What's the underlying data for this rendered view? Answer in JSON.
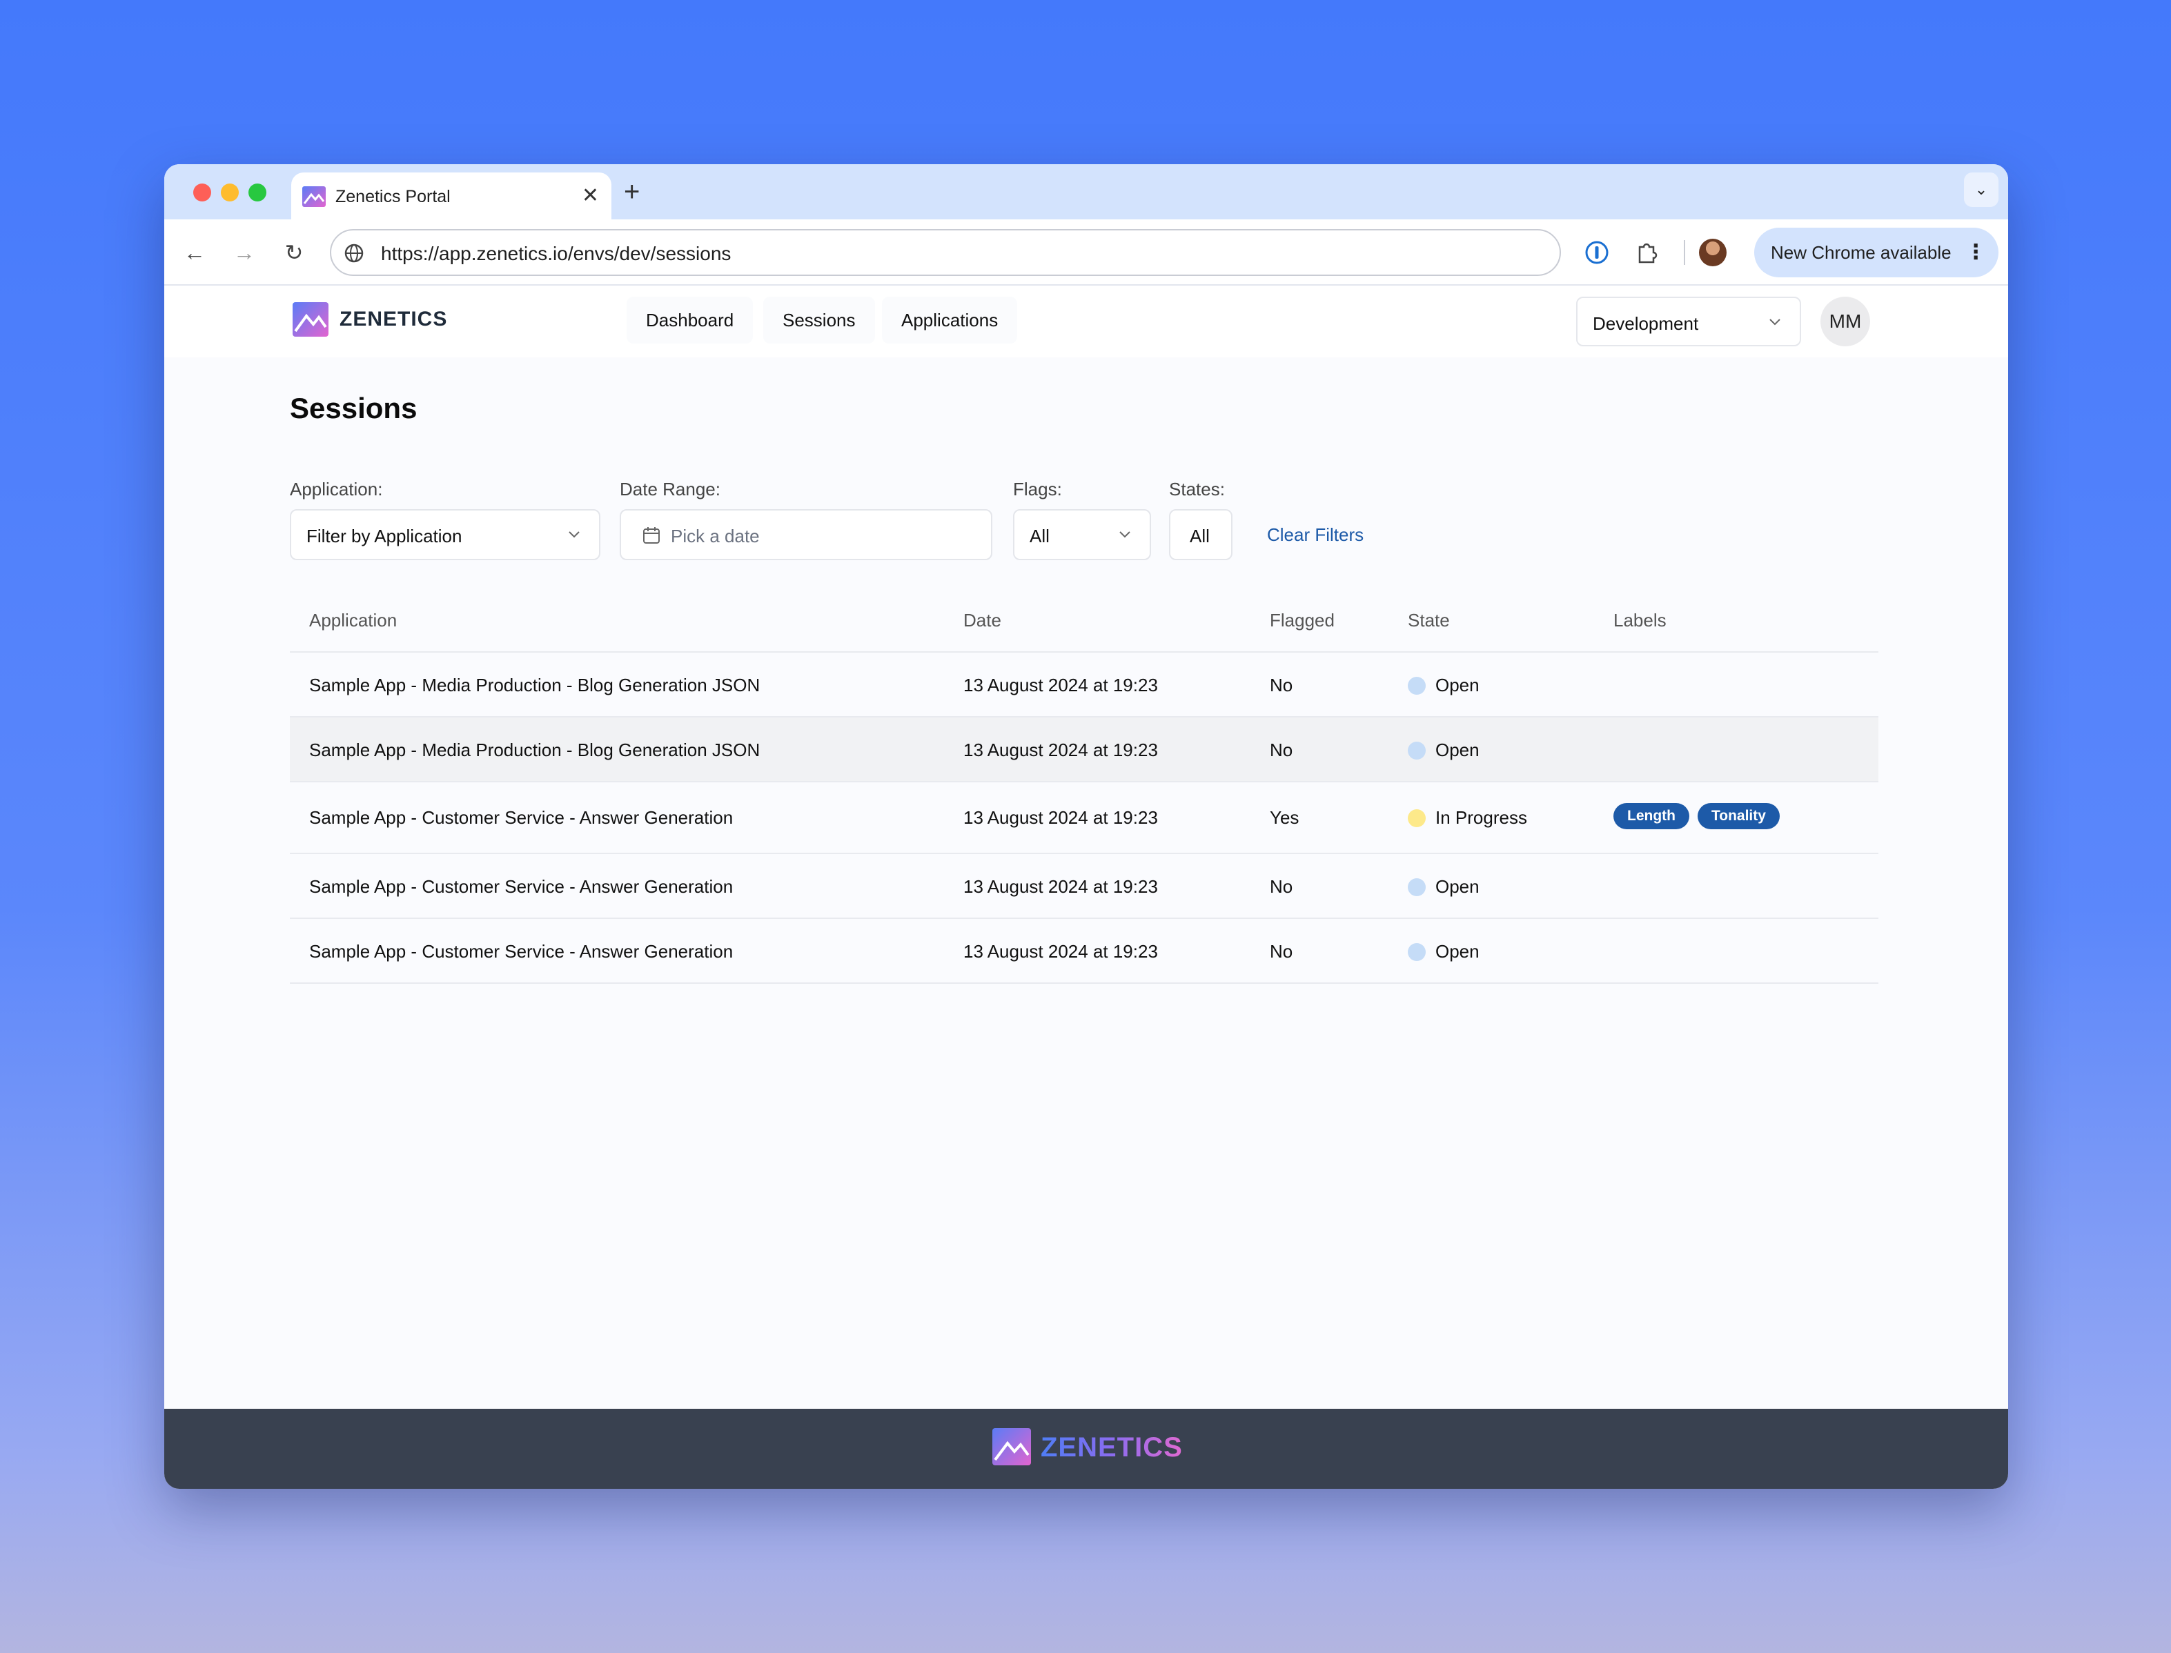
{
  "browser": {
    "tab_title": "Zenetics Portal",
    "tab_close": "✕",
    "new_tab": "+",
    "url": "https://app.zenetics.io/envs/dev/sessions",
    "update_button": "New Chrome available"
  },
  "header": {
    "logo_text": "ZENETICS",
    "nav": {
      "dashboard": "Dashboard",
      "sessions": "Sessions",
      "applications": "Applications"
    },
    "environment": "Development",
    "avatar_initials": "MM"
  },
  "page": {
    "title": "Sessions"
  },
  "filters": {
    "application_label": "Application:",
    "application_value": "Filter by Application",
    "date_label": "Date Range:",
    "date_placeholder": "Pick a date",
    "flags_label": "Flags:",
    "flags_value": "All",
    "states_label": "States:",
    "states_value": "All",
    "clear": "Clear Filters"
  },
  "table": {
    "headers": {
      "application": "Application",
      "date": "Date",
      "flagged": "Flagged",
      "state": "State",
      "labels": "Labels"
    },
    "rows": [
      {
        "application": "Sample App - Media Production - Blog Generation JSON",
        "date": "13 August 2024 at 19:23",
        "flagged": "No",
        "state": "Open",
        "labels": []
      },
      {
        "application": "Sample App - Media Production - Blog Generation JSON",
        "date": "13 August 2024 at 19:23",
        "flagged": "No",
        "state": "Open",
        "labels": []
      },
      {
        "application": "Sample App - Customer Service - Answer Generation",
        "date": "13 August 2024 at 19:23",
        "flagged": "Yes",
        "state": "In Progress",
        "labels": [
          "Length",
          "Tonality"
        ]
      },
      {
        "application": "Sample App - Customer Service - Answer Generation",
        "date": "13 August 2024 at 19:23",
        "flagged": "No",
        "state": "Open",
        "labels": []
      },
      {
        "application": "Sample App - Customer Service - Answer Generation",
        "date": "13 August 2024 at 19:23",
        "flagged": "No",
        "state": "Open",
        "labels": []
      }
    ]
  },
  "footer": {
    "logo_text": "ZENETICS"
  },
  "colors": {
    "accent": "#1d5aa8",
    "state_open": "#c5dcf7",
    "state_in_progress": "#fde98a",
    "footer_bg": "#394150"
  }
}
